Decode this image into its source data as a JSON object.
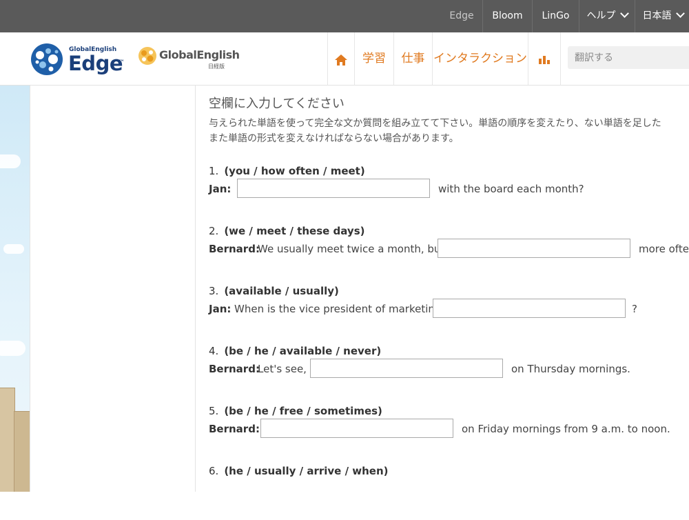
{
  "topbar": {
    "items": [
      {
        "label": "Edge"
      },
      {
        "label": "Bloom"
      },
      {
        "label": "LinGo"
      },
      {
        "label": "ヘルプ"
      },
      {
        "label": "日本語"
      }
    ]
  },
  "header": {
    "logo1": {
      "small": "GlobalEnglish",
      "big": "Edge",
      "tm": "™"
    },
    "logo2": {
      "name": "GlobalEnglish",
      "sub": "日経版"
    },
    "nav": [
      {
        "label": "学習"
      },
      {
        "label": "仕事"
      },
      {
        "label": "インタラクション"
      }
    ],
    "search_placeholder": "翻訳する"
  },
  "colors": {
    "accent": "#e07a20",
    "topbar": "#5a5a5a",
    "brand": "#1b3f7a"
  },
  "exercise": {
    "title": "空欄に入力してください",
    "instruction_line1": "与えられた単語を使って完全な文か質問を組み立てて下さい。単語の順序を変えたり、ない単語を足した",
    "instruction_line2": "また単語の形式を変えなければならない場合があります。",
    "questions": [
      {
        "num": "1.",
        "words": "(you / how often / meet)",
        "speaker": "Jan:",
        "before": "",
        "after": "with the board each month?"
      },
      {
        "num": "2.",
        "words": "(we / meet / these days)",
        "speaker": "Bernard:",
        "before": "We usually meet twice a month, but",
        "after": "more often"
      },
      {
        "num": "3.",
        "words": "(available / usually)",
        "speaker": "Jan:",
        "before": "When is the vice president of marketing",
        "after": "?"
      },
      {
        "num": "4.",
        "words": "(be / he / available / never)",
        "speaker": "Bernard:",
        "before": "Let's see,",
        "after": "on Thursday mornings."
      },
      {
        "num": "5.",
        "words": "(be / he / free / sometimes)",
        "speaker": "Bernard:",
        "before": "",
        "after": "on Friday mornings from 9 a.m. to noon."
      },
      {
        "num": "6.",
        "words": "(he / usually / arrive / when)"
      }
    ]
  }
}
